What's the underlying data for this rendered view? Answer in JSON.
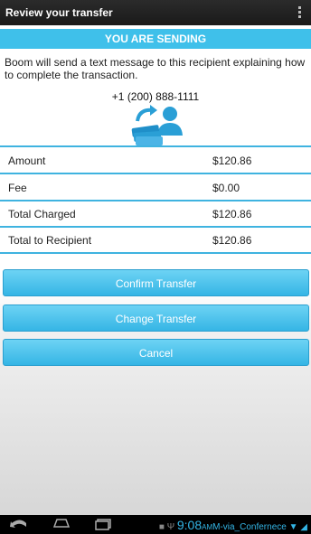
{
  "action_bar": {
    "title": "Review your transfer"
  },
  "banner": {
    "text": "YOU ARE SENDING"
  },
  "message": "Boom will send a text message to this recipient explaining how to complete the transaction.",
  "recipient": {
    "phone": "+1 (200) 888-1111"
  },
  "rows": [
    {
      "label": "Amount",
      "value": "$120.86"
    },
    {
      "label": "Fee",
      "value": "$0.00"
    },
    {
      "label": "Total Charged",
      "value": "$120.86"
    },
    {
      "label": "Total to Recipient",
      "value": "$120.86"
    }
  ],
  "buttons": {
    "confirm": "Confirm Transfer",
    "change": "Change Transfer",
    "cancel": "Cancel"
  },
  "status_bar": {
    "time": "9:08",
    "ampm": "AM",
    "network": "M-via_Confernece"
  },
  "colors": {
    "accent": "#3fc0ea",
    "action_bar": "#1f1f1f"
  }
}
